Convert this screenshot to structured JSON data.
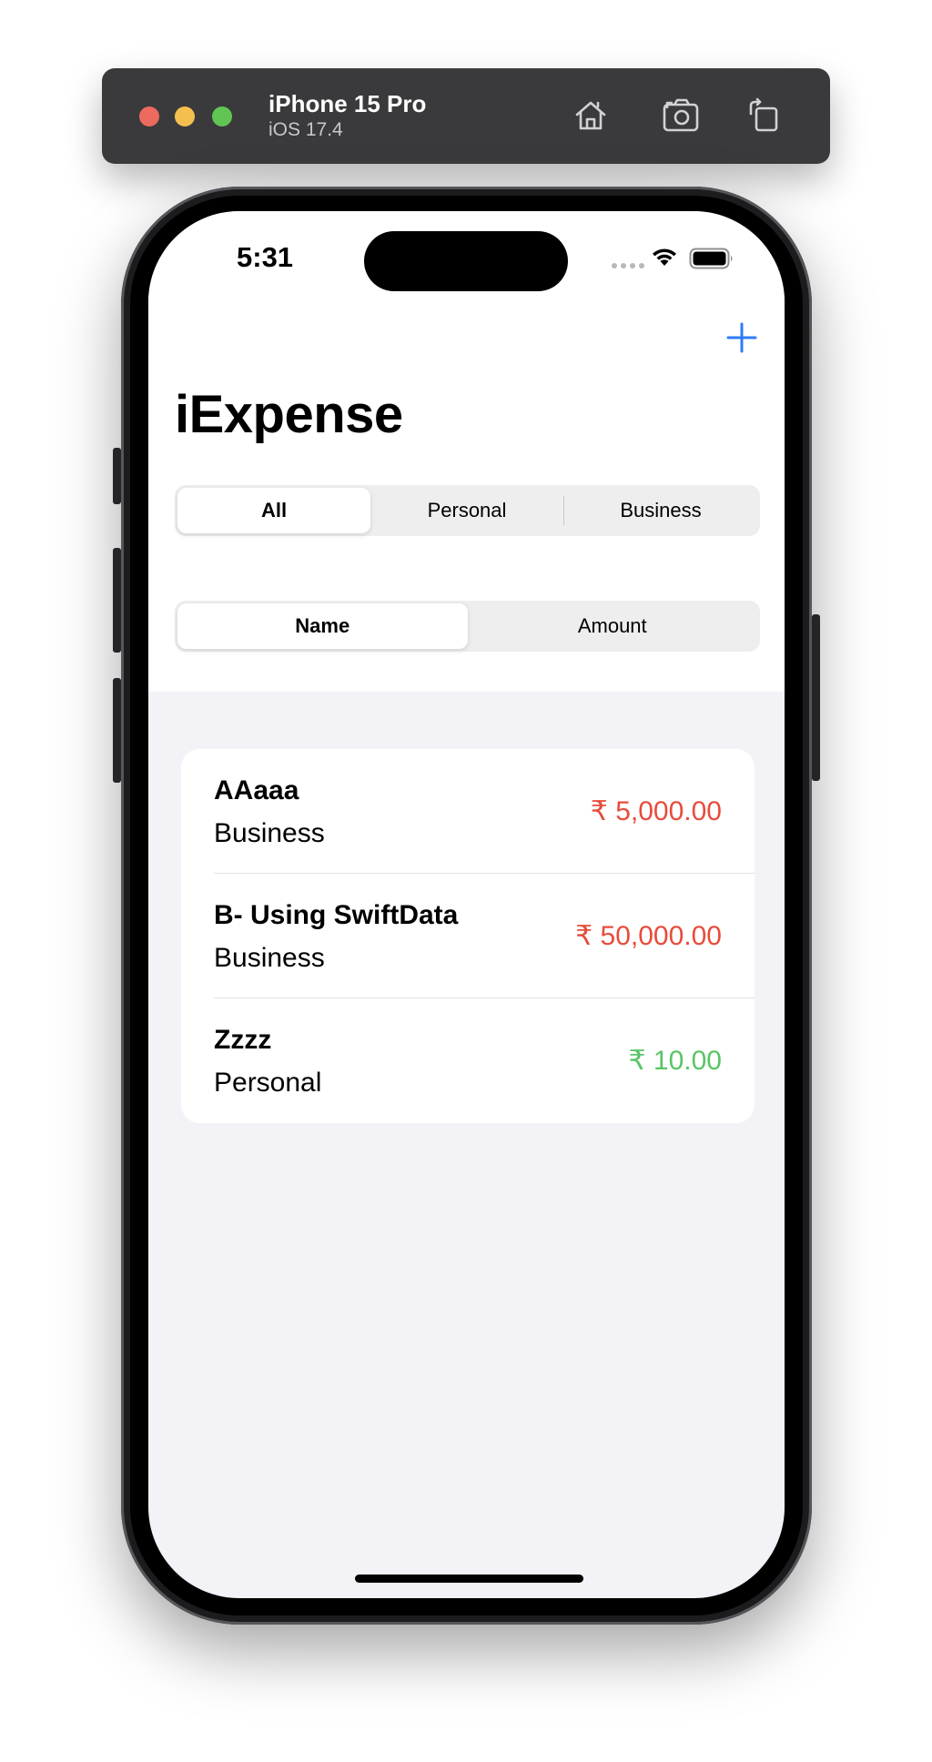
{
  "simulator": {
    "device_name": "iPhone 15 Pro",
    "os_version": "iOS 17.4",
    "toolbar_icons": [
      "home-icon",
      "screenshot-icon",
      "rotate-icon"
    ]
  },
  "status_bar": {
    "time": "5:31",
    "icons": [
      "cellular-icon",
      "wifi-icon",
      "battery-icon"
    ]
  },
  "nav": {
    "title": "iExpense",
    "add_icon": "plus-icon"
  },
  "filter_segment": {
    "options": [
      "All",
      "Personal",
      "Business"
    ],
    "selected": "All"
  },
  "sort_segment": {
    "options": [
      "Name",
      "Amount"
    ],
    "selected": "Name"
  },
  "expenses": [
    {
      "name": "AAaaa",
      "type": "Business",
      "amount": "₹ 5,000.00",
      "amount_color": "#e74c3c"
    },
    {
      "name": "B- Using SwiftData",
      "type": "Business",
      "amount": "₹ 50,000.00",
      "amount_color": "#e74c3c"
    },
    {
      "name": "Zzzz",
      "type": "Personal",
      "amount": "₹ 10.00",
      "amount_color": "#5ac466"
    }
  ],
  "colors": {
    "accent": "#2f7bf5",
    "background": "#f2f2f7",
    "expense_high": "#e74c3c",
    "expense_low": "#5ac466"
  }
}
